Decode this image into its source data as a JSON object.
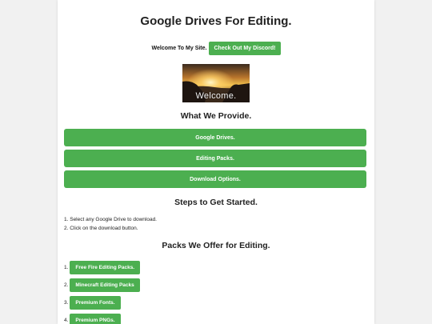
{
  "header": {
    "title": "Google Drives For Editing.",
    "welcome_text": "Welcome To My Site.",
    "discord_button": "Check Out My Discord!"
  },
  "banner": {
    "caption": "Welcome."
  },
  "provide": {
    "heading": "What We Provide.",
    "buttons": [
      "Google Drives.",
      "Editing Packs.",
      "Download Options."
    ]
  },
  "steps": {
    "heading": "Steps to Get Started.",
    "items": [
      {
        "num": "1.",
        "text": "Select any Google Drive to download."
      },
      {
        "num": "2.",
        "text": "Click on the download button."
      }
    ]
  },
  "packs": {
    "heading": "Packs We Offer for Editing.",
    "items": [
      {
        "num": "1.",
        "label": "Free Fire Editing Packs."
      },
      {
        "num": "2.",
        "label": "Minecraft Editing Packs"
      },
      {
        "num": "3.",
        "label": "Premium Fonts."
      },
      {
        "num": "4.",
        "label": "Premium PNGs."
      }
    ]
  },
  "colors": {
    "accent": "#4caf50",
    "page_background": "#f1f1f1",
    "card_background": "#ffffff"
  }
}
